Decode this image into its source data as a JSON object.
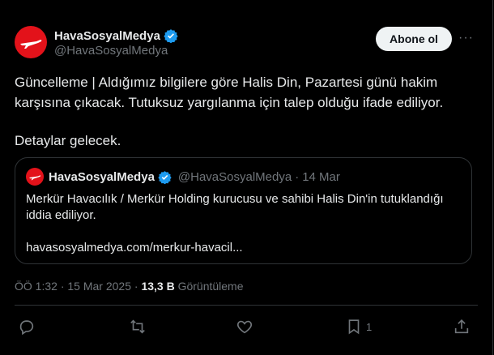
{
  "top_cut_text": "...",
  "tweet": {
    "author_name": "HavaSosyalMedya",
    "author_handle": "@HavaSosyalMedya",
    "follow_label": "Abone ol",
    "more_label": "···",
    "paragraph_1": "Güncelleme | Aldığımız bilgilere göre Halis Din, Pazartesi günü hakim karşısına çıkacak. Tutuksuz yargılanma için talep olduğu ifade ediliyor.",
    "paragraph_2": "Detaylar gelecek."
  },
  "quote": {
    "author_name": "HavaSosyalMedya",
    "author_handle": "@HavaSosyalMedya",
    "separator": "·",
    "date": "14 Mar",
    "text": "Merkür Havacılık / Merkür Holding kurucusu ve sahibi Halis Din'in tutuklandığı iddia ediliyor.",
    "link": "havasosyalmedya.com/merkur-havacil..."
  },
  "meta": {
    "time": "ÖÖ 1:32",
    "separator": "·",
    "date": "15 Mar 2025",
    "views_count": "13,3 B",
    "views_label": "Görüntüleme"
  },
  "actions": {
    "bookmark_count": "1"
  },
  "colors": {
    "background": "#000000",
    "brand_red": "#e3121a",
    "verified_blue": "#1d9bf0",
    "muted": "#71767b",
    "border": "#2f3336"
  }
}
